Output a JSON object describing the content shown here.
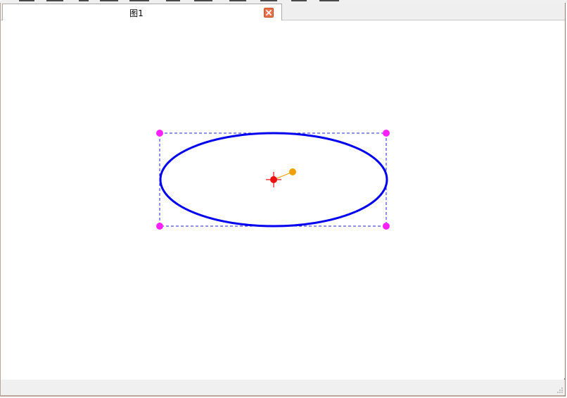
{
  "menubar": {
    "items": [
      "",
      "",
      "",
      "",
      "",
      "",
      "",
      "",
      "",
      "",
      ""
    ]
  },
  "tabs": [
    {
      "label": "图1",
      "active": true
    }
  ],
  "canvas": {
    "shape": "ellipse",
    "colors": {
      "ellipse_stroke": "#0000ee",
      "bounding_box": "#2222cc",
      "resize_handle": "#ff22ff",
      "center_marker": "#ee1111",
      "rotation_handle": "#f0a000",
      "rotation_line": "#f0a000"
    }
  },
  "icons": {
    "tab_close": "close-icon",
    "center": "crosshair-icon",
    "rotate": "rotation-handle-icon",
    "grip": "resize-grip-icon"
  }
}
